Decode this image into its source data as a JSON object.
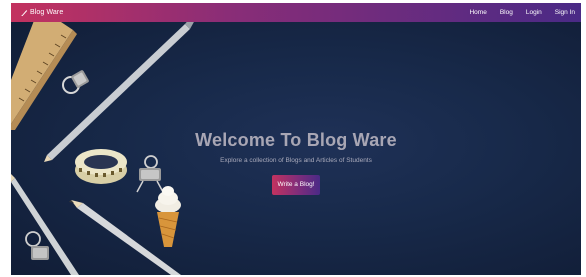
{
  "navbar": {
    "brand": "Blog Ware",
    "brand_icon": "pen-nib-icon",
    "links": [
      "Home",
      "Blog",
      "Login",
      "Sign In"
    ]
  },
  "hero": {
    "title": "Welcome To Blog Ware",
    "subtitle": "Explore a collection of Blogs and Articles of Students",
    "cta_label": "Write a Blog!"
  },
  "colors": {
    "nav_gradient_start": "#c3325f",
    "nav_gradient_end": "#4a2a86",
    "hero_background": "#172440",
    "title_color": "#a8a6b4"
  }
}
